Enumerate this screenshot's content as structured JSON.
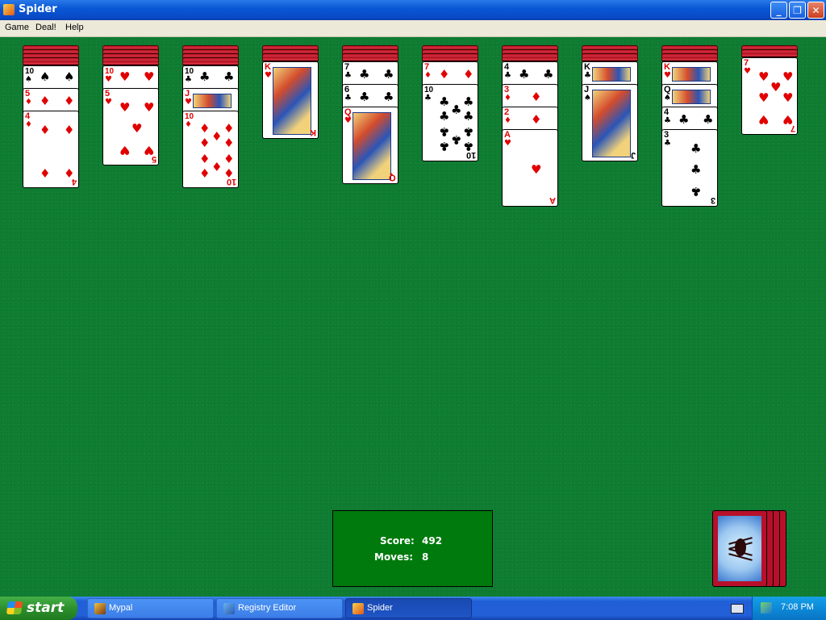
{
  "window": {
    "title": "Spider"
  },
  "menu": [
    "Game",
    "Deal!",
    "Help"
  ],
  "columns": [
    {
      "hidden": 4,
      "cards": [
        {
          "rank": "10",
          "suit": "spade"
        },
        {
          "rank": "5",
          "suit": "diamond"
        },
        {
          "rank": "4",
          "suit": "diamond"
        }
      ]
    },
    {
      "hidden": 4,
      "cards": [
        {
          "rank": "10",
          "suit": "heart"
        },
        {
          "rank": "5",
          "suit": "heart"
        }
      ]
    },
    {
      "hidden": 4,
      "cards": [
        {
          "rank": "10",
          "suit": "club"
        },
        {
          "rank": "J",
          "suit": "heart"
        },
        {
          "rank": "10",
          "suit": "diamond"
        }
      ]
    },
    {
      "hidden": 3,
      "cards": [
        {
          "rank": "K",
          "suit": "heart"
        }
      ]
    },
    {
      "hidden": 3,
      "cards": [
        {
          "rank": "7",
          "suit": "club"
        },
        {
          "rank": "6",
          "suit": "club"
        },
        {
          "rank": "Q",
          "suit": "heart"
        }
      ]
    },
    {
      "hidden": 3,
      "cards": [
        {
          "rank": "7",
          "suit": "diamond"
        },
        {
          "rank": "10",
          "suit": "club"
        }
      ]
    },
    {
      "hidden": 3,
      "cards": [
        {
          "rank": "4",
          "suit": "club"
        },
        {
          "rank": "3",
          "suit": "diamond"
        },
        {
          "rank": "2",
          "suit": "diamond"
        },
        {
          "rank": "A",
          "suit": "heart"
        }
      ]
    },
    {
      "hidden": 3,
      "cards": [
        {
          "rank": "K",
          "suit": "club"
        },
        {
          "rank": "J",
          "suit": "spade"
        }
      ]
    },
    {
      "hidden": 3,
      "cards": [
        {
          "rank": "K",
          "suit": "heart"
        },
        {
          "rank": "Q",
          "suit": "spade"
        },
        {
          "rank": "4",
          "suit": "club"
        },
        {
          "rank": "3",
          "suit": "club"
        }
      ]
    },
    {
      "hidden": 2,
      "cards": [
        {
          "rank": "7",
          "suit": "heart"
        }
      ]
    }
  ],
  "status": {
    "score_label": "Score:",
    "score": "492",
    "moves_label": "Moves:",
    "moves": "8"
  },
  "stock": {
    "remaining_deals": 4
  },
  "taskbar": {
    "start_label": "start",
    "tasks": [
      {
        "label": "Mypal",
        "active": false
      },
      {
        "label": "Registry Editor",
        "active": false
      },
      {
        "label": "Spider",
        "active": true
      }
    ],
    "clock": "7:08 PM"
  },
  "colors": {
    "felt": "#0f7d32",
    "red_suit": "#e00000",
    "card_back": "#c21a2c",
    "score_bg": "#007a0c"
  }
}
